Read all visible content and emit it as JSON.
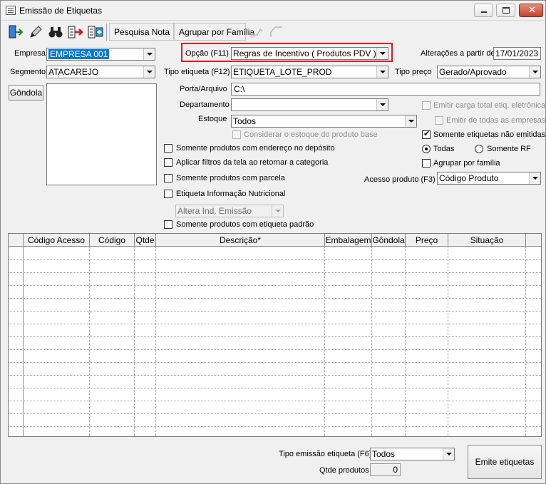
{
  "window": {
    "title": "Emissão de Etiquetas"
  },
  "toolbar": {
    "icons": [
      "exit-icon",
      "edit-icon",
      "binoculars-icon",
      "export-icon",
      "add-icon"
    ],
    "pesquisa_nota": "Pesquisa Nota",
    "agrupar_familia": "Agrupar por Família"
  },
  "form": {
    "empresa_label": "Empresa",
    "empresa_value": "EMPRESA 001",
    "opcao_label": "Opção (F11)",
    "opcao_value": "Regras de Incentivo ( Produtos PDV )",
    "alteracoes_label": "Alterações a partir de",
    "alteracoes_value": "17/01/2023",
    "segmento_label": "Segmento",
    "segmento_value": "ATACAREJO",
    "tipo_etiqueta_label": "Tipo etiqueta (F12)",
    "tipo_etiqueta_value": "ETIQUETA_LOTE_PROD",
    "tipo_preco_label": "Tipo preço",
    "tipo_preco_value": "Gerado/Aprovado",
    "gondola_button": "Gôndola",
    "porta_label": "Porta/Arquivo",
    "porta_value": "C:\\",
    "departamento_label": "Departamento",
    "departamento_value": "",
    "estoque_label": "Estoque",
    "estoque_value": "Todos",
    "considerar_estoque": "Considerar o estoque do produto base",
    "emitir_carga": "Emitir carga total etiq. eletrônica",
    "emitir_todas_empresas": "Emitir de todas as empresas",
    "somente_nao_emitidas": "Somente etiquetas não emitidas",
    "radio_todas": "Todas",
    "radio_somente_rf": "Somente RF",
    "agrupar_familia": "Agrupar por família",
    "somente_endereco": "Somente produtos com endereço no depósito",
    "aplicar_filtros": "Aplicar filtros da tela ao retornar a categoria",
    "somente_parcela": "Somente produtos com parcela",
    "etiqueta_nutricional": "Etiqueta Informação Nutricional",
    "acesso_produto_label": "Acesso produto (F3)",
    "acesso_produto_value": "Código Produto",
    "altera_ind_emissao": "Altera Ind. Emissão",
    "somente_etiqueta_padrao": "Somente produtos com etiqueta padrão"
  },
  "grid": {
    "columns": [
      "Código Acesso",
      "Código",
      "Qtde",
      "Descrição*",
      "Embalagem",
      "Gôndola",
      "Preço",
      "Situação"
    ],
    "row_count": 14
  },
  "footer": {
    "tipo_emissao_label": "Tipo emissão etiqueta (F6)",
    "tipo_emissao_value": "Todos",
    "qtde_produtos_label": "Qtde produtos",
    "qtde_produtos_value": "0",
    "emite_button": "Emite etiquetas"
  },
  "colors": {
    "highlight": "#e8171b",
    "selection": "#0078d7"
  }
}
